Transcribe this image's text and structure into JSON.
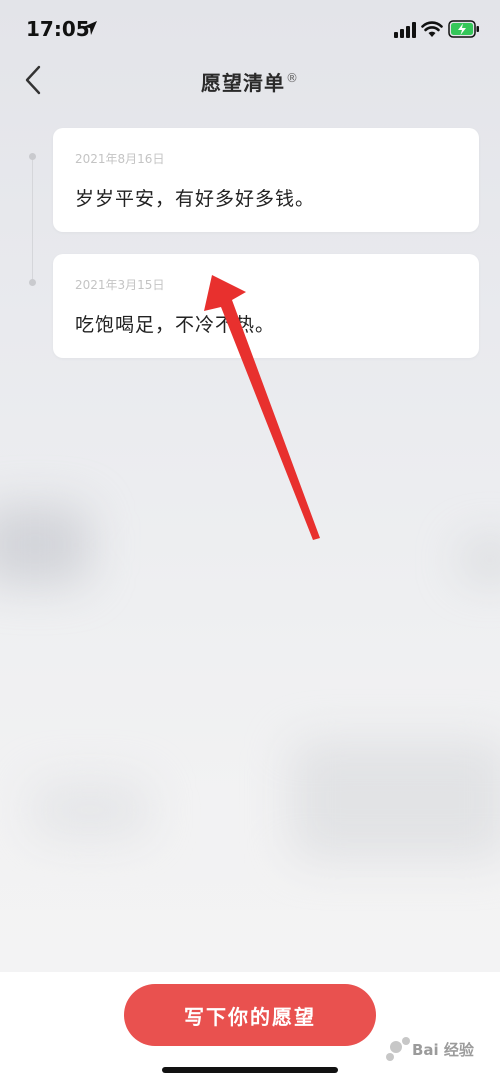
{
  "status_bar": {
    "time": "17:05"
  },
  "nav": {
    "title": "愿望清单",
    "title_mark": "®"
  },
  "wishes": [
    {
      "date": "2021年8月16日",
      "text": "岁岁平安，有好多好多钱。"
    },
    {
      "date": "2021年3月15日",
      "text": "吃饱喝足，不冷不热。"
    }
  ],
  "bottom": {
    "write_label": "写下你的愿望"
  },
  "watermark": {
    "text": "Bai 经验"
  },
  "colors": {
    "accent": "#e9514f",
    "arrow": "#e8302e",
    "battery": "#35c759"
  },
  "icons": [
    "location-arrow-icon",
    "cellular-signal-icon",
    "wifi-icon",
    "battery-charging-icon",
    "chevron-left-icon"
  ]
}
